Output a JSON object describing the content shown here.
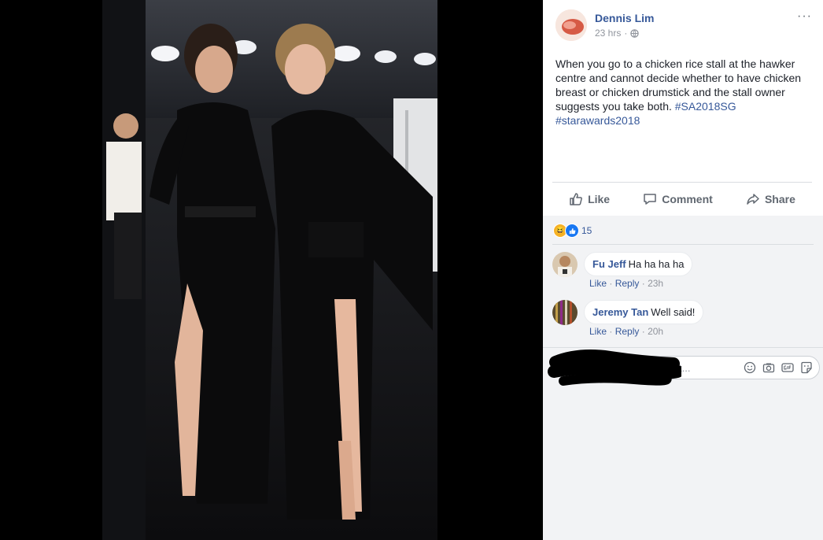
{
  "post": {
    "author": "Dennis Lim",
    "time": "23 hrs",
    "separator": "·",
    "text_main": "When you go to a chicken rice stall at the hawker centre and cannot decide whether to have chicken breast or chicken drumstick and the stall owner suggests you take both. ",
    "hashtag1": "#SA2018SG",
    "hashtag2": "#starawards2018",
    "more": "···"
  },
  "actions": {
    "like": "Like",
    "comment": "Comment",
    "share": "Share"
  },
  "reactions": {
    "count": "15",
    "icons": [
      "haha-icon",
      "like-icon"
    ]
  },
  "comments": [
    {
      "name": "Fu Jeff",
      "text": "Ha ha ha ha",
      "like": "Like",
      "reply": "Reply",
      "time": "23h",
      "dot": "·"
    },
    {
      "name": "Jeremy Tan",
      "text": "Well said!",
      "like": "Like",
      "reply": "Reply",
      "time": "20h",
      "dot": "·"
    }
  ],
  "composer": {
    "placeholder_visible": "t..."
  },
  "colors": {
    "link": "#365899",
    "muted": "#90949c",
    "panel_bg": "#ffffff",
    "comments_bg": "#f2f3f5"
  }
}
